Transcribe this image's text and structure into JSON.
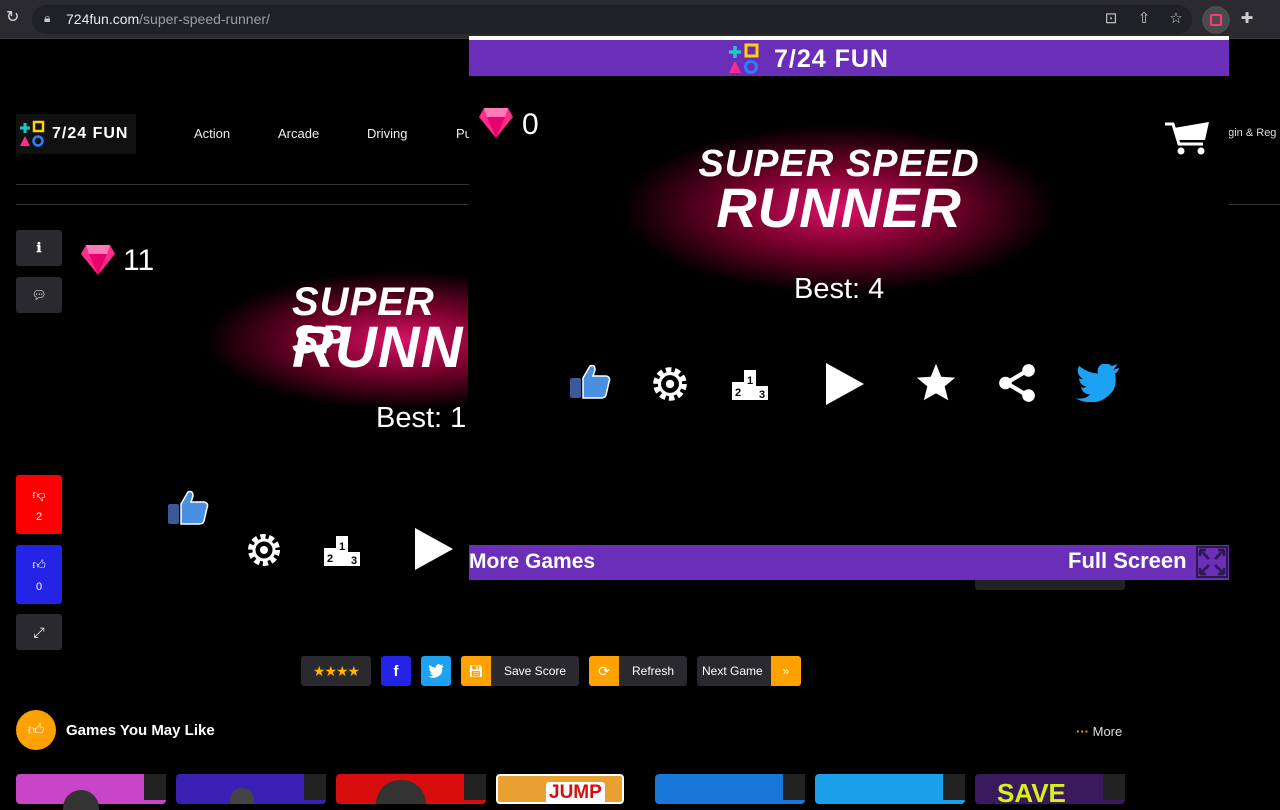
{
  "browser": {
    "url_domain": "724fun.com",
    "url_path": "/super-speed-runner/"
  },
  "site": {
    "logo_text": "7/24 FUN",
    "nav": [
      "Action",
      "Arcade",
      "Driving",
      "Pu"
    ],
    "login_text": "ogin & Reg",
    "gem_count": "11",
    "title_line1": "SUPER SP",
    "title_line2": "RUNN",
    "best": "Best: 1",
    "dislike_count": "2",
    "like_count": "0",
    "toolbar": {
      "save_score": "Save Score",
      "refresh": "Refresh",
      "next_game": "Next Game",
      "facebook": "f"
    },
    "games_you_may_like": "Games You May Like",
    "more": "More",
    "thumb_jump": "JUMP",
    "thumb_save": "SAVE"
  },
  "game": {
    "header_title": "7/24 FUN",
    "gem_count": "0",
    "title_line1": "SUPER SPEED",
    "title_line2": "RUNNER",
    "best": "Best: 4",
    "more_games": "More Games",
    "full_screen": "Full Screen"
  },
  "colors": {
    "purple": "#6b2eb8",
    "pink": "#ff2d8a",
    "red": "#ff0000",
    "blue": "#2424e6",
    "orange": "#ffa200",
    "twitter": "#1da1f2",
    "facebook": "#3b5998"
  }
}
